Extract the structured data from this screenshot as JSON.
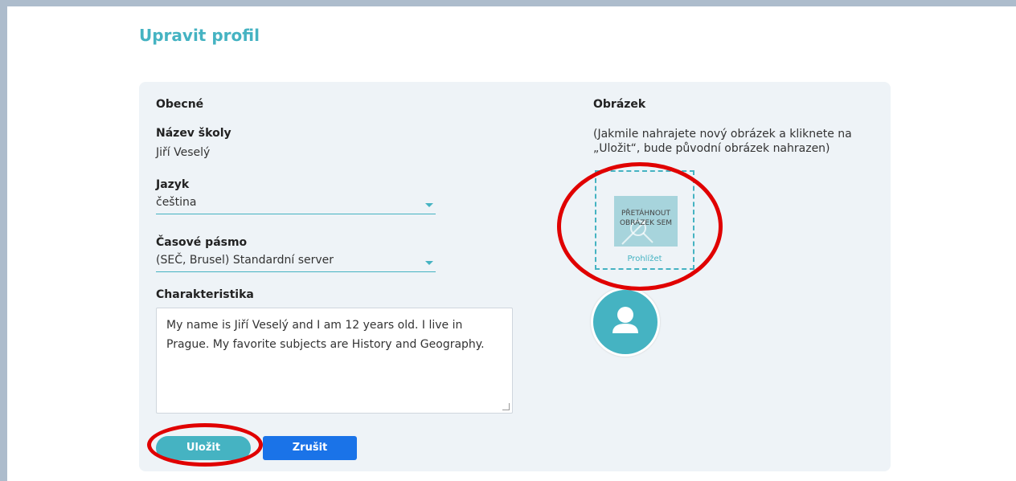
{
  "page": {
    "title": "Upravit profil"
  },
  "general": {
    "section_title": "Obecné",
    "school_name_label": "Název školy",
    "school_name_value": "Jiří Veselý",
    "language_label": "Jazyk",
    "language_value": "čeština",
    "timezone_label": "Časové pásmo",
    "timezone_value": "(SEČ, Brusel) Standardní server",
    "characteristics_label": "Charakteristika",
    "characteristics_value": "My name is Jiří Veselý and I am 12 years old. I live in Prague. My favorite subjects are History and Geography."
  },
  "picture": {
    "section_title": "Obrázek",
    "hint": "(Jakmile nahrajete nový obrázek a kliknete na „Uložit“, bude původní obrázek nahrazen)",
    "drop_text": "PŘETÁHNOUT OBRÁZEK SEM",
    "browse_label": "Prohlížet",
    "avatar_icon": "user-icon"
  },
  "actions": {
    "save_label": "Uložit",
    "cancel_label": "Zrušit"
  },
  "colors": {
    "accent": "#45b3c2",
    "primary_button": "#1a73e8",
    "annotation": "#e00000"
  }
}
